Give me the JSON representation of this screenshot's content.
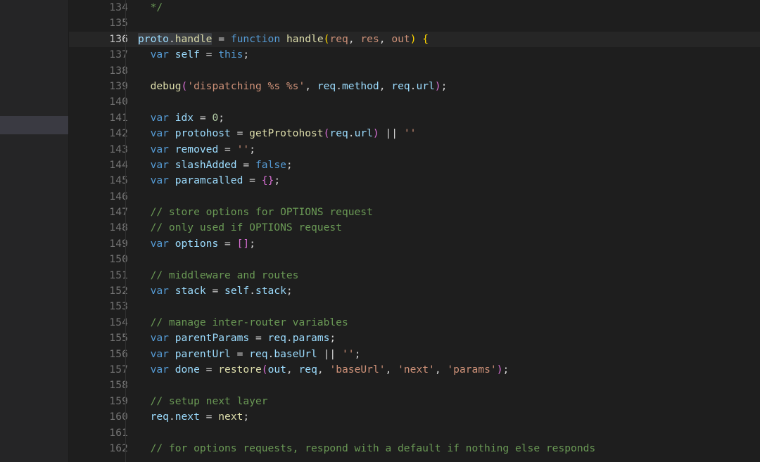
{
  "editor": {
    "theme_name": "dark-plus",
    "colors": {
      "background": "#1e1e1e",
      "gutter_background": "#1e1e1e",
      "strip_background": "#252526",
      "strip_thumb": "#3a3a42",
      "active_line_background": "#262626",
      "line_number": "#757575",
      "line_number_active": "#c8c8c8",
      "selection": "#3a3d41",
      "text": "#d4d4d4",
      "comment": "#6a9955",
      "keyword": "#569cd6",
      "function": "#dcdcaa",
      "variable": "#9cdcfe",
      "string": "#ce9178",
      "number": "#b5cea8",
      "bracket_yellow": "#ffd700",
      "bracket_magenta": "#da70d6",
      "bracket_blue": "#179fff"
    },
    "first_line_number": 134,
    "active_line_number": 136,
    "selected_text": "proto.handle",
    "lines": [
      {
        "number": 134,
        "text": "*/",
        "tokens": [
          {
            "t": "  ",
            "c": "t-plain"
          },
          {
            "t": "*/",
            "c": "t-comment"
          }
        ]
      },
      {
        "number": 135,
        "text": "",
        "tokens": []
      },
      {
        "number": 136,
        "text": "proto.handle = function handle(req, res, out) {",
        "active": true,
        "tokens": [
          {
            "t": "proto",
            "c": "t-var",
            "sel": true
          },
          {
            "t": ".",
            "c": "t-plain",
            "sel": true
          },
          {
            "t": "handle",
            "c": "t-func",
            "sel": true
          },
          {
            "t": " ",
            "c": "t-plain"
          },
          {
            "t": "=",
            "c": "t-op"
          },
          {
            "t": " ",
            "c": "t-plain"
          },
          {
            "t": "function",
            "c": "t-keyword"
          },
          {
            "t": " ",
            "c": "t-plain"
          },
          {
            "t": "handle",
            "c": "t-func"
          },
          {
            "t": "(",
            "c": "t-brack1"
          },
          {
            "t": "req",
            "c": "t-param"
          },
          {
            "t": ", ",
            "c": "t-plain"
          },
          {
            "t": "res",
            "c": "t-param"
          },
          {
            "t": ", ",
            "c": "t-plain"
          },
          {
            "t": "out",
            "c": "t-param"
          },
          {
            "t": ")",
            "c": "t-brack1"
          },
          {
            "t": " ",
            "c": "t-plain"
          },
          {
            "t": "{",
            "c": "t-brack1"
          }
        ]
      },
      {
        "number": 137,
        "text": "  var self = this;",
        "tokens": [
          {
            "t": "  ",
            "c": "t-plain"
          },
          {
            "t": "var",
            "c": "t-keyword"
          },
          {
            "t": " ",
            "c": "t-plain"
          },
          {
            "t": "self",
            "c": "t-var"
          },
          {
            "t": " = ",
            "c": "t-op"
          },
          {
            "t": "this",
            "c": "t-keyword"
          },
          {
            "t": ";",
            "c": "t-plain"
          }
        ]
      },
      {
        "number": 138,
        "text": "",
        "tokens": []
      },
      {
        "number": 139,
        "text": "  debug('dispatching %s %s', req.method, req.url);",
        "tokens": [
          {
            "t": "  ",
            "c": "t-plain"
          },
          {
            "t": "debug",
            "c": "t-func"
          },
          {
            "t": "(",
            "c": "t-brack2"
          },
          {
            "t": "'dispatching %s %s'",
            "c": "t-string"
          },
          {
            "t": ", ",
            "c": "t-plain"
          },
          {
            "t": "req",
            "c": "t-var"
          },
          {
            "t": ".",
            "c": "t-plain"
          },
          {
            "t": "method",
            "c": "t-var"
          },
          {
            "t": ", ",
            "c": "t-plain"
          },
          {
            "t": "req",
            "c": "t-var"
          },
          {
            "t": ".",
            "c": "t-plain"
          },
          {
            "t": "url",
            "c": "t-var"
          },
          {
            "t": ")",
            "c": "t-brack2"
          },
          {
            "t": ";",
            "c": "t-plain"
          }
        ]
      },
      {
        "number": 140,
        "text": "",
        "tokens": []
      },
      {
        "number": 141,
        "text": "  var idx = 0;",
        "tokens": [
          {
            "t": "  ",
            "c": "t-plain"
          },
          {
            "t": "var",
            "c": "t-keyword"
          },
          {
            "t": " ",
            "c": "t-plain"
          },
          {
            "t": "idx",
            "c": "t-var"
          },
          {
            "t": " = ",
            "c": "t-op"
          },
          {
            "t": "0",
            "c": "t-number"
          },
          {
            "t": ";",
            "c": "t-plain"
          }
        ]
      },
      {
        "number": 142,
        "text": "  var protohost = getProtohost(req.url) || ''",
        "tokens": [
          {
            "t": "  ",
            "c": "t-plain"
          },
          {
            "t": "var",
            "c": "t-keyword"
          },
          {
            "t": " ",
            "c": "t-plain"
          },
          {
            "t": "protohost",
            "c": "t-var"
          },
          {
            "t": " = ",
            "c": "t-op"
          },
          {
            "t": "getProtohost",
            "c": "t-func"
          },
          {
            "t": "(",
            "c": "t-brack2"
          },
          {
            "t": "req",
            "c": "t-var"
          },
          {
            "t": ".",
            "c": "t-plain"
          },
          {
            "t": "url",
            "c": "t-var"
          },
          {
            "t": ")",
            "c": "t-brack2"
          },
          {
            "t": " ",
            "c": "t-plain"
          },
          {
            "t": "||",
            "c": "t-op"
          },
          {
            "t": " ",
            "c": "t-plain"
          },
          {
            "t": "''",
            "c": "t-string"
          }
        ]
      },
      {
        "number": 143,
        "text": "  var removed = '';",
        "tokens": [
          {
            "t": "  ",
            "c": "t-plain"
          },
          {
            "t": "var",
            "c": "t-keyword"
          },
          {
            "t": " ",
            "c": "t-plain"
          },
          {
            "t": "removed",
            "c": "t-var"
          },
          {
            "t": " = ",
            "c": "t-op"
          },
          {
            "t": "''",
            "c": "t-string"
          },
          {
            "t": ";",
            "c": "t-plain"
          }
        ]
      },
      {
        "number": 144,
        "text": "  var slashAdded = false;",
        "tokens": [
          {
            "t": "  ",
            "c": "t-plain"
          },
          {
            "t": "var",
            "c": "t-keyword"
          },
          {
            "t": " ",
            "c": "t-plain"
          },
          {
            "t": "slashAdded",
            "c": "t-var"
          },
          {
            "t": " = ",
            "c": "t-op"
          },
          {
            "t": "false",
            "c": "t-keyword"
          },
          {
            "t": ";",
            "c": "t-plain"
          }
        ]
      },
      {
        "number": 145,
        "text": "  var paramcalled = {};",
        "tokens": [
          {
            "t": "  ",
            "c": "t-plain"
          },
          {
            "t": "var",
            "c": "t-keyword"
          },
          {
            "t": " ",
            "c": "t-plain"
          },
          {
            "t": "paramcalled",
            "c": "t-var"
          },
          {
            "t": " = ",
            "c": "t-op"
          },
          {
            "t": "{",
            "c": "t-brack2"
          },
          {
            "t": "}",
            "c": "t-brack2"
          },
          {
            "t": ";",
            "c": "t-plain"
          }
        ]
      },
      {
        "number": 146,
        "text": "",
        "tokens": []
      },
      {
        "number": 147,
        "text": "  // store options for OPTIONS request",
        "tokens": [
          {
            "t": "  ",
            "c": "t-plain"
          },
          {
            "t": "// store options for OPTIONS request",
            "c": "t-comment"
          }
        ]
      },
      {
        "number": 148,
        "text": "  // only used if OPTIONS request",
        "tokens": [
          {
            "t": "  ",
            "c": "t-plain"
          },
          {
            "t": "// only used if OPTIONS request",
            "c": "t-comment"
          }
        ]
      },
      {
        "number": 149,
        "text": "  var options = [];",
        "tokens": [
          {
            "t": "  ",
            "c": "t-plain"
          },
          {
            "t": "var",
            "c": "t-keyword"
          },
          {
            "t": " ",
            "c": "t-plain"
          },
          {
            "t": "options",
            "c": "t-var"
          },
          {
            "t": " = ",
            "c": "t-op"
          },
          {
            "t": "[",
            "c": "t-brack2"
          },
          {
            "t": "]",
            "c": "t-brack2"
          },
          {
            "t": ";",
            "c": "t-plain"
          }
        ]
      },
      {
        "number": 150,
        "text": "",
        "tokens": []
      },
      {
        "number": 151,
        "text": "  // middleware and routes",
        "tokens": [
          {
            "t": "  ",
            "c": "t-plain"
          },
          {
            "t": "// middleware and routes",
            "c": "t-comment"
          }
        ]
      },
      {
        "number": 152,
        "text": "  var stack = self.stack;",
        "tokens": [
          {
            "t": "  ",
            "c": "t-plain"
          },
          {
            "t": "var",
            "c": "t-keyword"
          },
          {
            "t": " ",
            "c": "t-plain"
          },
          {
            "t": "stack",
            "c": "t-var"
          },
          {
            "t": " = ",
            "c": "t-op"
          },
          {
            "t": "self",
            "c": "t-var"
          },
          {
            "t": ".",
            "c": "t-plain"
          },
          {
            "t": "stack",
            "c": "t-var"
          },
          {
            "t": ";",
            "c": "t-plain"
          }
        ]
      },
      {
        "number": 153,
        "text": "",
        "tokens": []
      },
      {
        "number": 154,
        "text": "  // manage inter-router variables",
        "tokens": [
          {
            "t": "  ",
            "c": "t-plain"
          },
          {
            "t": "// manage inter-router variables",
            "c": "t-comment"
          }
        ]
      },
      {
        "number": 155,
        "text": "  var parentParams = req.params;",
        "tokens": [
          {
            "t": "  ",
            "c": "t-plain"
          },
          {
            "t": "var",
            "c": "t-keyword"
          },
          {
            "t": " ",
            "c": "t-plain"
          },
          {
            "t": "parentParams",
            "c": "t-var"
          },
          {
            "t": " = ",
            "c": "t-op"
          },
          {
            "t": "req",
            "c": "t-var"
          },
          {
            "t": ".",
            "c": "t-plain"
          },
          {
            "t": "params",
            "c": "t-var"
          },
          {
            "t": ";",
            "c": "t-plain"
          }
        ]
      },
      {
        "number": 156,
        "text": "  var parentUrl = req.baseUrl || '';",
        "tokens": [
          {
            "t": "  ",
            "c": "t-plain"
          },
          {
            "t": "var",
            "c": "t-keyword"
          },
          {
            "t": " ",
            "c": "t-plain"
          },
          {
            "t": "parentUrl",
            "c": "t-var"
          },
          {
            "t": " = ",
            "c": "t-op"
          },
          {
            "t": "req",
            "c": "t-var"
          },
          {
            "t": ".",
            "c": "t-plain"
          },
          {
            "t": "baseUrl",
            "c": "t-var"
          },
          {
            "t": " ",
            "c": "t-plain"
          },
          {
            "t": "||",
            "c": "t-op"
          },
          {
            "t": " ",
            "c": "t-plain"
          },
          {
            "t": "''",
            "c": "t-string"
          },
          {
            "t": ";",
            "c": "t-plain"
          }
        ]
      },
      {
        "number": 157,
        "text": "  var done = restore(out, req, 'baseUrl', 'next', 'params');",
        "tokens": [
          {
            "t": "  ",
            "c": "t-plain"
          },
          {
            "t": "var",
            "c": "t-keyword"
          },
          {
            "t": " ",
            "c": "t-plain"
          },
          {
            "t": "done",
            "c": "t-var"
          },
          {
            "t": " = ",
            "c": "t-op"
          },
          {
            "t": "restore",
            "c": "t-func"
          },
          {
            "t": "(",
            "c": "t-brack2"
          },
          {
            "t": "out",
            "c": "t-var"
          },
          {
            "t": ", ",
            "c": "t-plain"
          },
          {
            "t": "req",
            "c": "t-var"
          },
          {
            "t": ", ",
            "c": "t-plain"
          },
          {
            "t": "'baseUrl'",
            "c": "t-string"
          },
          {
            "t": ", ",
            "c": "t-plain"
          },
          {
            "t": "'next'",
            "c": "t-string"
          },
          {
            "t": ", ",
            "c": "t-plain"
          },
          {
            "t": "'params'",
            "c": "t-string"
          },
          {
            "t": ")",
            "c": "t-brack2"
          },
          {
            "t": ";",
            "c": "t-plain"
          }
        ]
      },
      {
        "number": 158,
        "text": "",
        "tokens": []
      },
      {
        "number": 159,
        "text": "  // setup next layer",
        "tokens": [
          {
            "t": "  ",
            "c": "t-plain"
          },
          {
            "t": "// setup next layer",
            "c": "t-comment"
          }
        ]
      },
      {
        "number": 160,
        "text": "  req.next = next;",
        "tokens": [
          {
            "t": "  ",
            "c": "t-plain"
          },
          {
            "t": "req",
            "c": "t-var"
          },
          {
            "t": ".",
            "c": "t-plain"
          },
          {
            "t": "next",
            "c": "t-var"
          },
          {
            "t": " = ",
            "c": "t-op"
          },
          {
            "t": "next",
            "c": "t-func"
          },
          {
            "t": ";",
            "c": "t-plain"
          }
        ]
      },
      {
        "number": 161,
        "text": "",
        "tokens": []
      },
      {
        "number": 162,
        "text": "  // for options requests, respond with a default if nothing else responds",
        "tokens": [
          {
            "t": "  ",
            "c": "t-plain"
          },
          {
            "t": "// for options requests, respond with a default if nothing else responds",
            "c": "t-comment"
          }
        ]
      }
    ]
  }
}
